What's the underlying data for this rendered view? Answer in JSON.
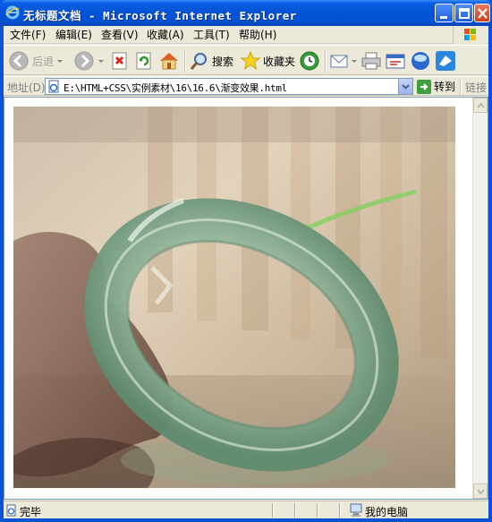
{
  "window": {
    "title": "无标题文档 - Microsoft Internet Explorer"
  },
  "menu": {
    "items": [
      "文件(F)",
      "编辑(E)",
      "查看(V)",
      "收藏(A)",
      "工具(T)",
      "帮助(H)"
    ]
  },
  "toolbar": {
    "back_label": "后退",
    "search_label": "搜索",
    "favorites_label": "收藏夹"
  },
  "address": {
    "label": "地址(D)",
    "url": "E:\\HTML+CSS\\实例素材\\16\\16.6\\渐变效果.html",
    "go_label": "转到",
    "links_label": "链接"
  },
  "status": {
    "text": "完毕",
    "zone": "我的电脑"
  },
  "colors": {
    "titlebar": "#0253d6",
    "chrome": "#ece9d8",
    "jade": "#8fb59a"
  }
}
